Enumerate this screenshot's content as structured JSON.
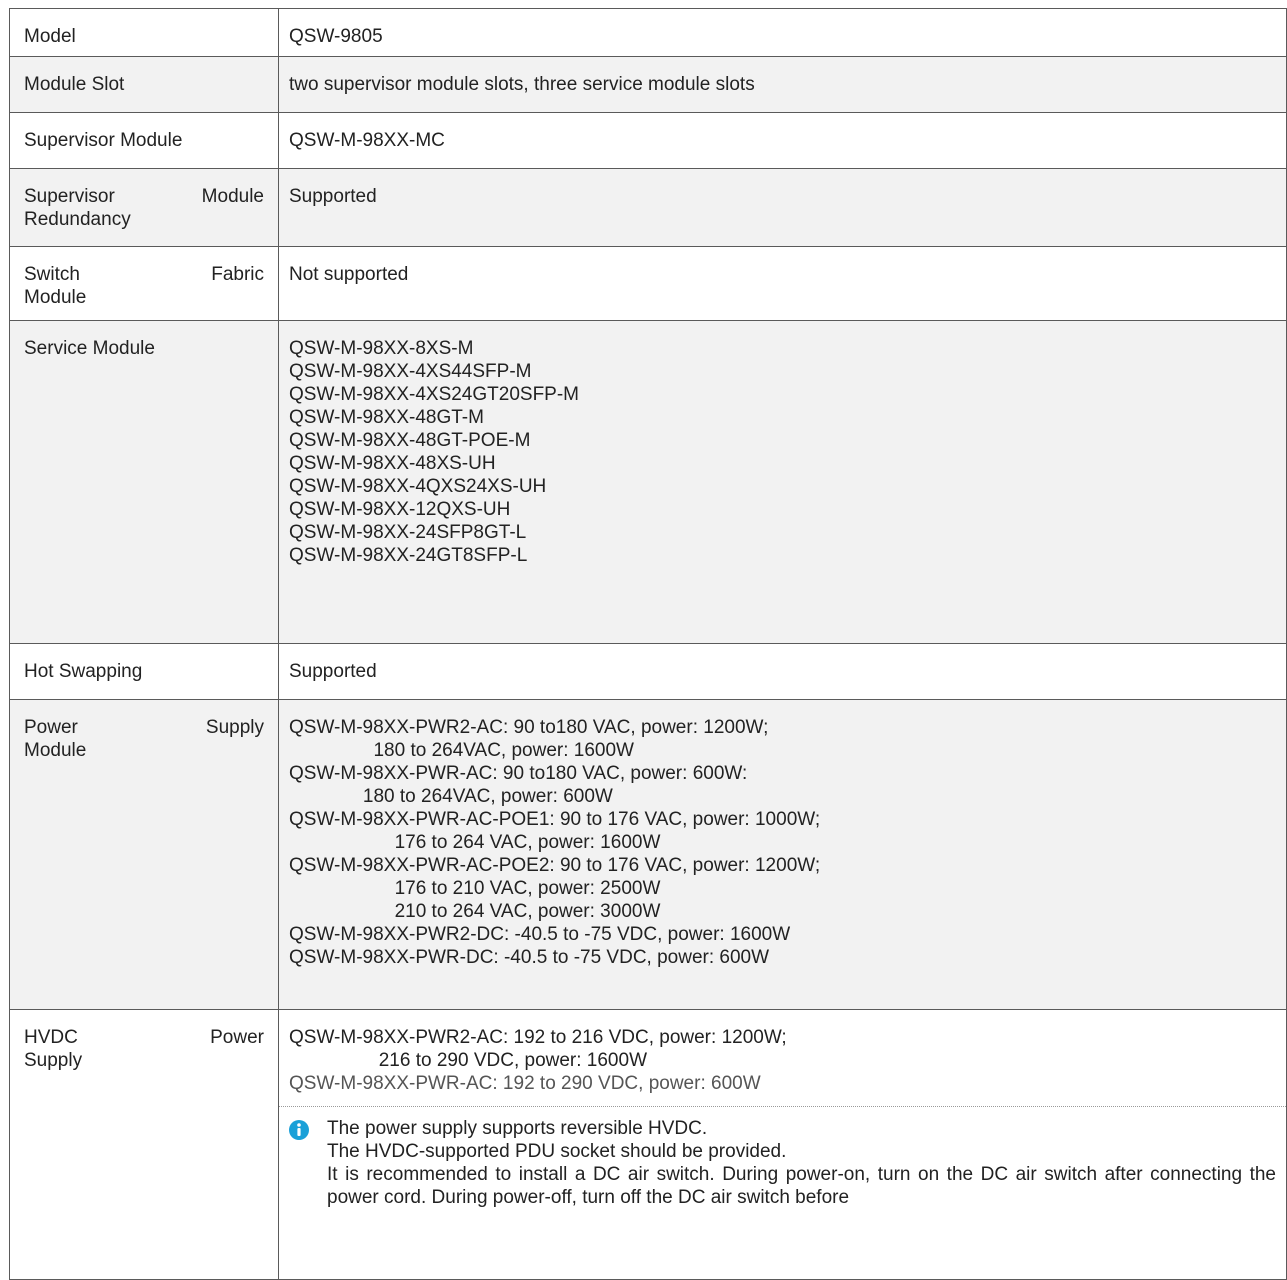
{
  "rows": [
    {
      "label": "Model",
      "value": "QSW-9805"
    },
    {
      "label": "Module Slot",
      "value": "two supervisor module slots, three service module slots"
    },
    {
      "label": "Supervisor Module",
      "value": "QSW-M-98XX-MC"
    },
    {
      "label_lines": [
        "Supervisor Module",
        "Redundancy"
      ],
      "value": "Supported"
    },
    {
      "label_lines": [
        "Switch Fabric",
        "Module"
      ],
      "value": "Not supported"
    },
    {
      "label": "Service Module",
      "lines": [
        "QSW-M-98XX-8XS-M",
        "QSW-M-98XX-4XS44SFP-M",
        "QSW-M-98XX-4XS24GT20SFP-M",
        "QSW-M-98XX-48GT-M",
        "QSW-M-98XX-48GT-POE-M",
        "QSW-M-98XX-48XS-UH",
        "QSW-M-98XX-4QXS24XS-UH",
        "QSW-M-98XX-12QXS-UH",
        "QSW-M-98XX-24SFP8GT-L",
        "QSW-M-98XX-24GT8SFP-L"
      ]
    },
    {
      "label": "Hot Swapping",
      "value": "Supported"
    },
    {
      "label_lines": [
        "Power Supply",
        "Module"
      ],
      "lines": [
        "QSW-M-98XX-PWR2-AC: 90 to180 VAC, power: 1200W;",
        "                180 to 264VAC, power: 1600W",
        "QSW-M-98XX-PWR-AC: 90 to180 VAC, power: 600W:",
        "              180 to 264VAC, power: 600W",
        "QSW-M-98XX-PWR-AC-POE1: 90 to 176 VAC, power: 1000W;",
        "                    176 to 264 VAC, power: 1600W",
        "QSW-M-98XX-PWR-AC-POE2: 90 to 176 VAC, power: 1200W;",
        "                    176 to 210 VAC, power: 2500W",
        "                    210 to 264 VAC, power: 3000W",
        "QSW-M-98XX-PWR2-DC: -40.5 to -75 VDC, power: 1600W",
        "QSW-M-98XX-PWR-DC: -40.5 to -75 VDC, power: 600W"
      ]
    },
    {
      "label_lines": [
        "HVDC Power",
        "Supply"
      ],
      "lines": [
        "QSW-M-98XX-PWR2-AC: 192 to 216 VDC, power: 1200W;",
        "                 216 to 290 VDC, power: 1600W",
        "QSW-M-98XX-PWR-AC: 192 to 290 VDC, power: 600W"
      ],
      "note": {
        "icon": "info-icon",
        "lines": [
          "The power supply supports reversible HVDC.",
          "The HVDC-supported PDU socket should be provided.",
          "It is recommended to install a DC air switch. During power-on, turn on the DC air switch after connecting the power cord. During power-off, turn off the DC air switch before"
        ]
      }
    }
  ],
  "colors": {
    "shade": "#f2f2f2",
    "border": "#5a5a5a",
    "info_icon": "#1aa0d8"
  }
}
